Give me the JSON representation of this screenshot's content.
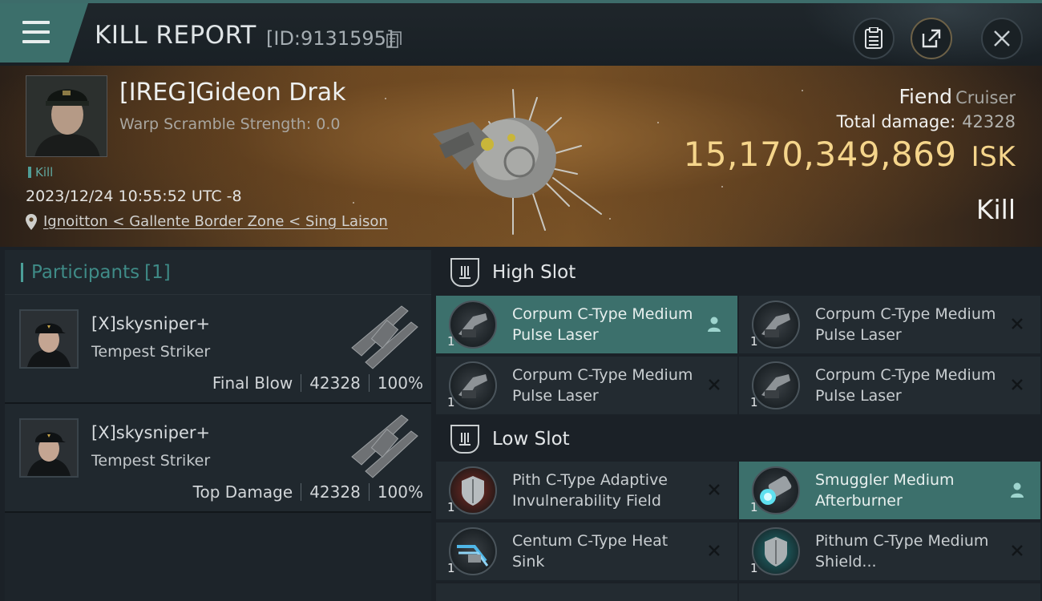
{
  "header": {
    "title": "KILL REPORT",
    "report_id": "[ID:9131595]"
  },
  "victim": {
    "name": "[IREG]Gideon Drak",
    "warp_scramble": "Warp Scramble Strength: 0.0",
    "tag": "Kill",
    "datetime": "2023/12/24 10:55:52 UTC -8",
    "location": "Ignoitton < Gallente Border Zone < Sing Laison",
    "ship": "Fiend",
    "ship_class": "Cruiser",
    "total_damage_label": "Total damage:",
    "total_damage": "42328",
    "isk_value": "15,170,349,869",
    "isk_unit": "ISK",
    "result": "Kill"
  },
  "participants": {
    "title": "Participants",
    "count": "[1]",
    "rows": [
      {
        "name": "[X]skysniper+",
        "ship": "Tempest Striker",
        "role": "Final Blow",
        "damage": "42328",
        "percent": "100%"
      },
      {
        "name": "[X]skysniper+",
        "ship": "Tempest Striker",
        "role": "Top Damage",
        "damage": "42328",
        "percent": "100%"
      }
    ]
  },
  "slots": {
    "high": {
      "title": "High Slot",
      "modules": [
        {
          "name": "Corpum C-Type Medium Pulse Laser",
          "qty": "1",
          "status": "dropped"
        },
        {
          "name": "Corpum C-Type Medium Pulse Laser",
          "qty": "1",
          "status": "destroyed"
        },
        {
          "name": "Corpum C-Type Medium Pulse Laser",
          "qty": "1",
          "status": "destroyed"
        },
        {
          "name": "Corpum C-Type Medium Pulse Laser",
          "qty": "1",
          "status": "destroyed"
        }
      ]
    },
    "low": {
      "title": "Low Slot",
      "modules": [
        {
          "name": "Pith C-Type Adaptive Invulnerability Field",
          "qty": "1",
          "status": "destroyed"
        },
        {
          "name": "Smuggler Medium Afterburner",
          "qty": "1",
          "status": "dropped"
        },
        {
          "name": "Centum C-Type Heat Sink",
          "qty": "1",
          "status": "destroyed"
        },
        {
          "name": "Pithum C-Type Medium Shield...",
          "qty": "1",
          "status": "destroyed"
        }
      ]
    }
  },
  "colors": {
    "accent": "#3c706c",
    "isk": "#f5d58b",
    "participants_title": "#3f8b87"
  },
  "icons": {
    "menu": "hamburger-icon",
    "copy": "copy-icon",
    "report": "clipboard-icon",
    "share": "share-icon",
    "close": "close-icon",
    "location": "location-pin-icon",
    "slot": "slot-icon",
    "dropped": "person-icon",
    "destroyed": "x-icon"
  }
}
